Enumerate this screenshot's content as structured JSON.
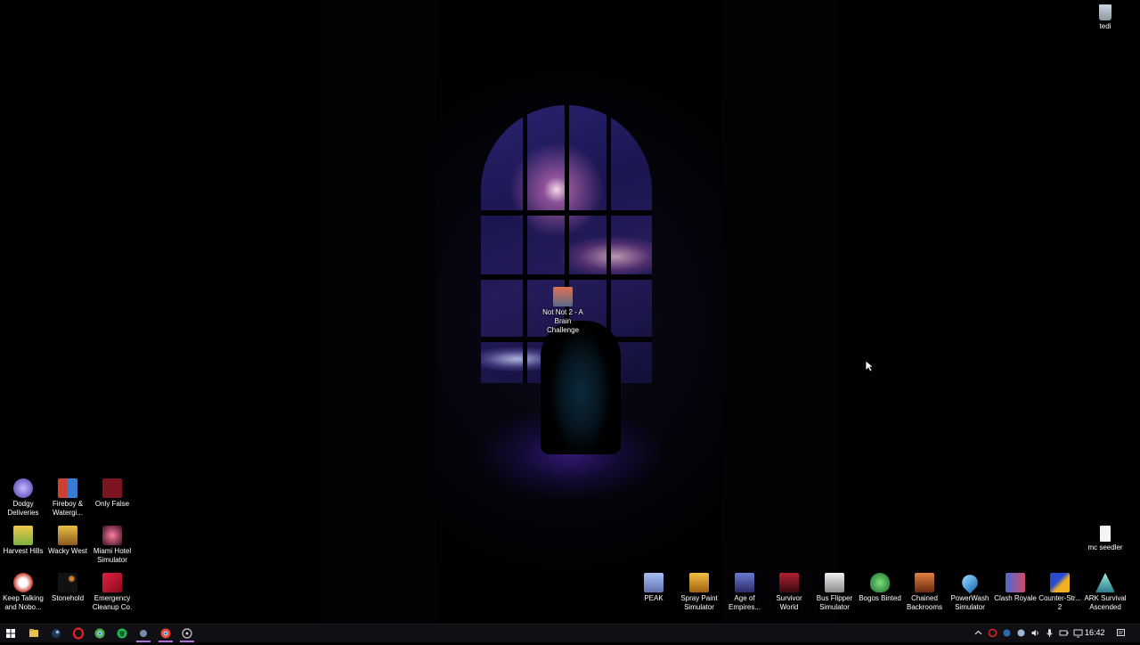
{
  "desktop": {
    "icons": [
      {
        "label": "tedi",
        "icon": "recycle-bin-icon",
        "color": "#aab4c0"
      },
      {
        "label": "Not Not 2 - A Brain Challenge",
        "icon": "notnot2-icon",
        "color": "#d46a4a"
      },
      {
        "label": "Dodgy Deliveries",
        "icon": "dodgy-deliveries-icon",
        "color": "#5a4ab8"
      },
      {
        "label": "Fireboy & Watergi...",
        "icon": "fireboy-watergirl-icon",
        "color": "#c0392b"
      },
      {
        "label": "Only False",
        "icon": "only-false-icon",
        "color": "#b0202a"
      },
      {
        "label": "Harvest Hills",
        "icon": "harvest-hills-icon",
        "color": "#e6b23c"
      },
      {
        "label": "Wacky West",
        "icon": "wacky-west-icon",
        "color": "#d4a017"
      },
      {
        "label": "Miami Hotel Simulator",
        "icon": "miami-hotel-icon",
        "color": "#6a1a3a"
      },
      {
        "label": "Keep Talking and Nobo...",
        "icon": "keep-talking-icon",
        "color": "#c43a2a"
      },
      {
        "label": "Stonehold",
        "icon": "stonehold-icon",
        "color": "#333333"
      },
      {
        "label": "Emergency Cleanup Co.",
        "icon": "emergency-cleanup-icon",
        "color": "#c81e3a"
      },
      {
        "label": "mc seedler",
        "icon": "text-file-icon",
        "color": "#f2f2f2"
      },
      {
        "label": "PEAK",
        "icon": "peak-icon",
        "color": "#7b8fd1"
      },
      {
        "label": "Spray Paint Simulator",
        "icon": "spray-paint-icon",
        "color": "#d49a22"
      },
      {
        "label": "Age of Empires...",
        "icon": "age-of-empires-icon",
        "color": "#3a4a9a"
      },
      {
        "label": "Survivor World",
        "icon": "survivor-world-icon",
        "color": "#8a1c22"
      },
      {
        "label": "Bus Flipper Simulator",
        "icon": "bus-flipper-icon",
        "color": "#dddddd"
      },
      {
        "label": "Bogos Binted",
        "icon": "bogos-binted-icon",
        "color": "#3aa84a"
      },
      {
        "label": "Chained Backrooms",
        "icon": "chained-backrooms-icon",
        "color": "#c4622a"
      },
      {
        "label": "PowerWash Simulator",
        "icon": "powerwash-icon",
        "color": "#4aa0e0"
      },
      {
        "label": "Clash Royale",
        "icon": "clash-royale-icon",
        "color": "#5a7ad8"
      },
      {
        "label": "Counter-Str... 2",
        "icon": "counter-strike-icon",
        "color": "#e0a020"
      },
      {
        "label": "ARK Survival Ascended",
        "icon": "ark-icon",
        "color": "#5ab0a0"
      }
    ]
  },
  "taskbar": {
    "start_icon": "windows-start-icon",
    "pinned": [
      {
        "icon": "file-explorer-icon",
        "color": "#e8c050"
      },
      {
        "icon": "steam-icon",
        "color": "#9ab8d8"
      },
      {
        "icon": "opera-icon",
        "color": "#e0202a"
      },
      {
        "icon": "chrome-icon",
        "color": "#4caf50"
      },
      {
        "icon": "spotify-icon",
        "color": "#1db954"
      },
      {
        "icon": "app-icon",
        "color": "#7a8aa8"
      },
      {
        "icon": "chrome-profile-icon",
        "color": "#e24a3a"
      },
      {
        "icon": "obs-icon",
        "color": "#cfcfcf"
      }
    ],
    "tray": [
      "chevron-up-icon",
      "opera-tray-icon",
      "network-tray-icon",
      "steam-tray-icon",
      "volume-icon",
      "microphone-icon",
      "battery-icon",
      "display-icon",
      "keyboard-icon"
    ],
    "clock": "16:42",
    "notification_icon": "notification-icon"
  }
}
